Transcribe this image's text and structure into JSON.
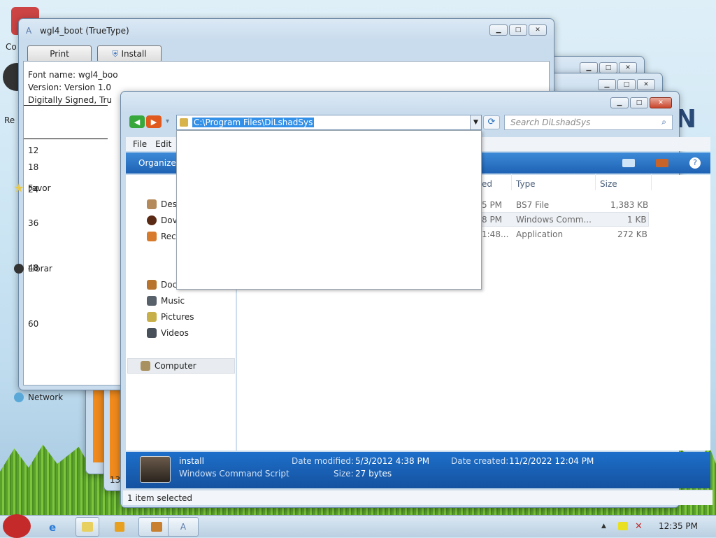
{
  "font_window": {
    "title": "wgl4_boot (TrueType)",
    "print_label": "Print",
    "install_label": "Install",
    "font_name": "Font name: wgl4_boo",
    "version": "Version: Version 1.0",
    "signed": "Digitally Signed, Tru",
    "sizes": [
      "12",
      "18",
      "24",
      "36",
      "48",
      "60"
    ]
  },
  "explorer": {
    "address": "C:\\Program Files\\DiLshadSys",
    "search_placeholder": "Search DiLshadSys",
    "menu": [
      "File",
      "Edit"
    ],
    "organize_label": "Organize",
    "nav": {
      "favorites": "Favor",
      "desktop": "Des",
      "downloads": "Dov",
      "recent": "Rec",
      "libraries": "Librar",
      "documents": "Doc",
      "music": "Music",
      "pictures": "Pictures",
      "videos": "Videos",
      "computer": "Computer",
      "network": "Network"
    },
    "columns": {
      "date": "ed",
      "type": "Type",
      "size": "Size"
    },
    "rows": [
      {
        "date": "5 PM",
        "type": "BS7 File",
        "size": "1,383 KB"
      },
      {
        "date": "8 PM",
        "type": "Windows Comm...",
        "size": "1 KB"
      },
      {
        "date": "1:48...",
        "type": "Application",
        "size": "272 KB"
      }
    ],
    "details": {
      "name": "install",
      "kind": "Windows Command Script",
      "modified_label": "Date modified:",
      "modified": "5/3/2012 4:38 PM",
      "size_label": "Size:",
      "size": "27 bytes",
      "created_label": "Date created:",
      "created": "11/2/2022 12:04 PM"
    },
    "status": "1 item selected"
  },
  "background_window": {
    "left_label": "F",
    "bottom_number": "13"
  },
  "desktop_labels": {
    "top": "Co",
    "mid": "Re"
  },
  "taskbar": {
    "clock": "12:35 PM"
  },
  "colors": {
    "accent": "#1e62b4",
    "selection": "#3390e8"
  }
}
